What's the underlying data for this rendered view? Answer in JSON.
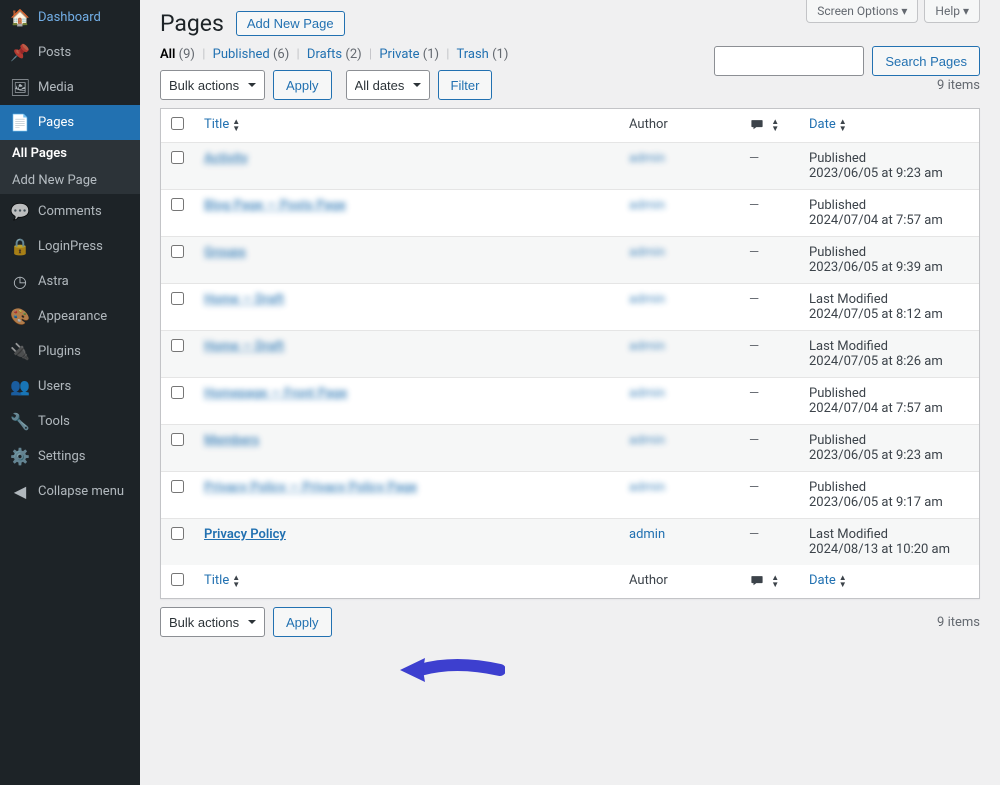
{
  "topTabs": {
    "screenOptions": "Screen Options ▾",
    "help": "Help ▾"
  },
  "sidebar": {
    "items": [
      {
        "icon": "🏠",
        "label": "Dashboard"
      },
      {
        "icon": "📌",
        "label": "Posts"
      },
      {
        "icon": "🖼",
        "label": "Media"
      },
      {
        "icon": "📄",
        "label": "Pages",
        "current": true,
        "submenu": [
          {
            "label": "All Pages",
            "current": true
          },
          {
            "label": "Add New Page"
          }
        ]
      },
      {
        "icon": "💬",
        "label": "Comments"
      },
      {
        "icon": "🔒",
        "label": "LoginPress"
      },
      {
        "icon": "◷",
        "label": "Astra"
      },
      {
        "icon": "🎨",
        "label": "Appearance"
      },
      {
        "icon": "🔌",
        "label": "Plugins"
      },
      {
        "icon": "👥",
        "label": "Users"
      },
      {
        "icon": "🔧",
        "label": "Tools"
      },
      {
        "icon": "⚙️",
        "label": "Settings"
      },
      {
        "icon": "◀",
        "label": "Collapse menu"
      }
    ]
  },
  "header": {
    "title": "Pages",
    "addNew": "Add New Page"
  },
  "filters": {
    "all": {
      "label": "All",
      "count": "(9)"
    },
    "published": {
      "label": "Published",
      "count": "(6)"
    },
    "drafts": {
      "label": "Drafts",
      "count": "(2)"
    },
    "private": {
      "label": "Private",
      "count": "(1)"
    },
    "trash": {
      "label": "Trash",
      "count": "(1)"
    }
  },
  "bulk": {
    "label": "Bulk actions",
    "apply": "Apply"
  },
  "dateFilter": {
    "label": "All dates",
    "filter": "Filter"
  },
  "search": {
    "button": "Search Pages"
  },
  "itemsCount": "9 items",
  "columns": {
    "title": "Title",
    "author": "Author",
    "date": "Date"
  },
  "rows": [
    {
      "title": "Activity",
      "author": "admin",
      "comments": "—",
      "status": "Published",
      "date": "2023/06/05 at 9:23 am",
      "blur": true
    },
    {
      "title": "Blog Page — Posts Page",
      "author": "admin",
      "comments": "—",
      "status": "Published",
      "date": "2024/07/04 at 7:57 am",
      "blur": true
    },
    {
      "title": "Groups",
      "author": "admin",
      "comments": "—",
      "status": "Published",
      "date": "2023/06/05 at 9:39 am",
      "blur": true
    },
    {
      "title": "Home — Draft",
      "author": "admin",
      "comments": "—",
      "status": "Last Modified",
      "date": "2024/07/05 at 8:12 am",
      "blur": true
    },
    {
      "title": "Home — Draft",
      "author": "admin",
      "comments": "—",
      "status": "Last Modified",
      "date": "2024/07/05 at 8:26 am",
      "blur": true
    },
    {
      "title": "Homepage — Front Page",
      "author": "admin",
      "comments": "—",
      "status": "Published",
      "date": "2024/07/04 at 7:57 am",
      "blur": true
    },
    {
      "title": "Members",
      "author": "admin",
      "comments": "—",
      "status": "Published",
      "date": "2023/06/05 at 9:23 am",
      "blur": true
    },
    {
      "title": "Privacy Policy — Privacy Policy Page",
      "author": "admin",
      "comments": "—",
      "status": "Published",
      "date": "2023/06/05 at 9:17 am",
      "blur": true
    },
    {
      "title": "Privacy Policy",
      "author": "admin",
      "comments": "—",
      "status": "Last Modified",
      "date": "2024/08/13 at 10:20 am",
      "blur": false
    }
  ]
}
